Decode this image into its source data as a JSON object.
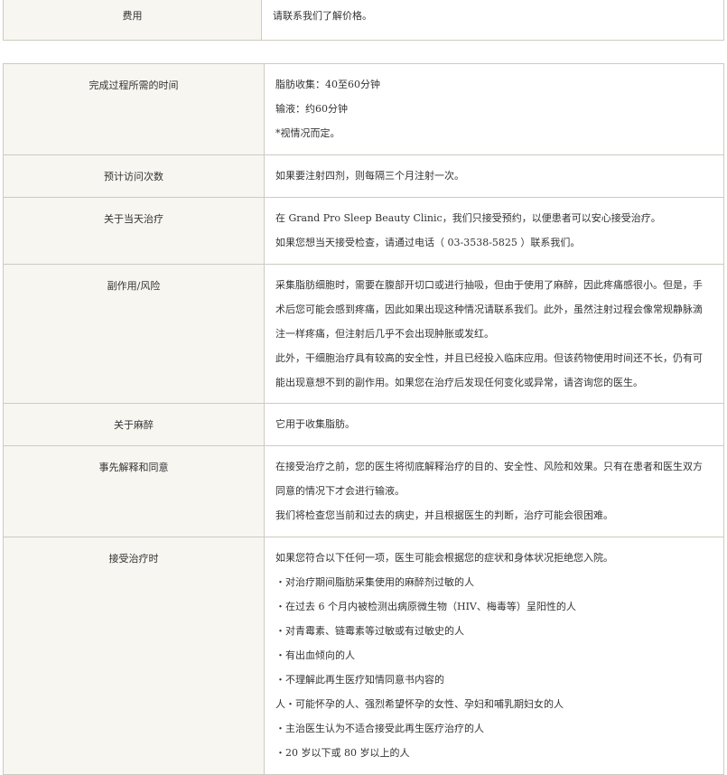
{
  "fee": {
    "label": "费用",
    "value": "请联系我们了解价格。"
  },
  "rows": {
    "time": {
      "label": "完成过程所需的时间",
      "lines": [
        "脂肪收集：40至60分钟",
        "输液：约60分钟",
        "*视情况而定。"
      ]
    },
    "visits": {
      "label": "预计访问次数",
      "lines": [
        "如果要注射四剂，则每隔三个月注射一次。"
      ]
    },
    "sameday": {
      "label": "关于当天治疗",
      "lines": [
        "在 Grand Pro Sleep Beauty Clinic，我们只接受预约，以便患者可以安心接受治疗。",
        "如果您想当天接受检查，请通过电话（ 03-3538-5825 ）联系我们。"
      ]
    },
    "risk": {
      "label": "副作用/风险",
      "lines": [
        "采集脂肪细胞时，需要在腹部开切口或进行抽吸，但由于使用了麻醉，因此疼痛感很小。但是，手",
        "术后您可能会感到疼痛，因此如果出现这种情况请联系我们。此外，虽然注射过程会像常规静脉滴",
        "注一样疼痛，但注射后几乎不会出现肿胀或发红。",
        "此外，干细胞治疗具有较高的安全性，并且已经投入临床应用。但该药物使用时间还不长，仍有可",
        "能出现意想不到的副作用。如果您在治疗后发现任何变化或异常，请咨询您的医生。"
      ]
    },
    "anes": {
      "label": "关于麻醉",
      "lines": [
        "它用于收集脂肪。"
      ]
    },
    "consent": {
      "label": "事先解释和同意",
      "lines": [
        "在接受治疗之前，您的医生将彻底解释治疗的目的、安全性、风险和效果。只有在患者和医生双方",
        "同意的情况下才会进行输液。",
        "我们将检查您当前和过去的病史，并且根据医生的判断，治疗可能会很困难。"
      ]
    },
    "accept": {
      "label": "接受治疗时",
      "lines": [
        "如果您符合以下任何一项，医生可能会根据您的症状和身体状况拒绝您入院。",
        "・对治疗期间脂肪采集使用的麻醉剂过敏的人",
        "・在过去 6 个月内被检测出病原微生物（HIV、梅毒等）呈阳性的人",
        "・对青霉素、链霉素等过敏或有过敏史的人",
        "・有出血倾向的人",
        "・不理解此再生医疗知情同意书内容的",
        "人・可能怀孕的人、强烈希望怀孕的女性、孕妇和哺乳期妇女的人",
        "・主治医生认为不适合接受此再生医疗治疗的人",
        "・20 岁以下或 80 岁以上的人"
      ]
    }
  }
}
